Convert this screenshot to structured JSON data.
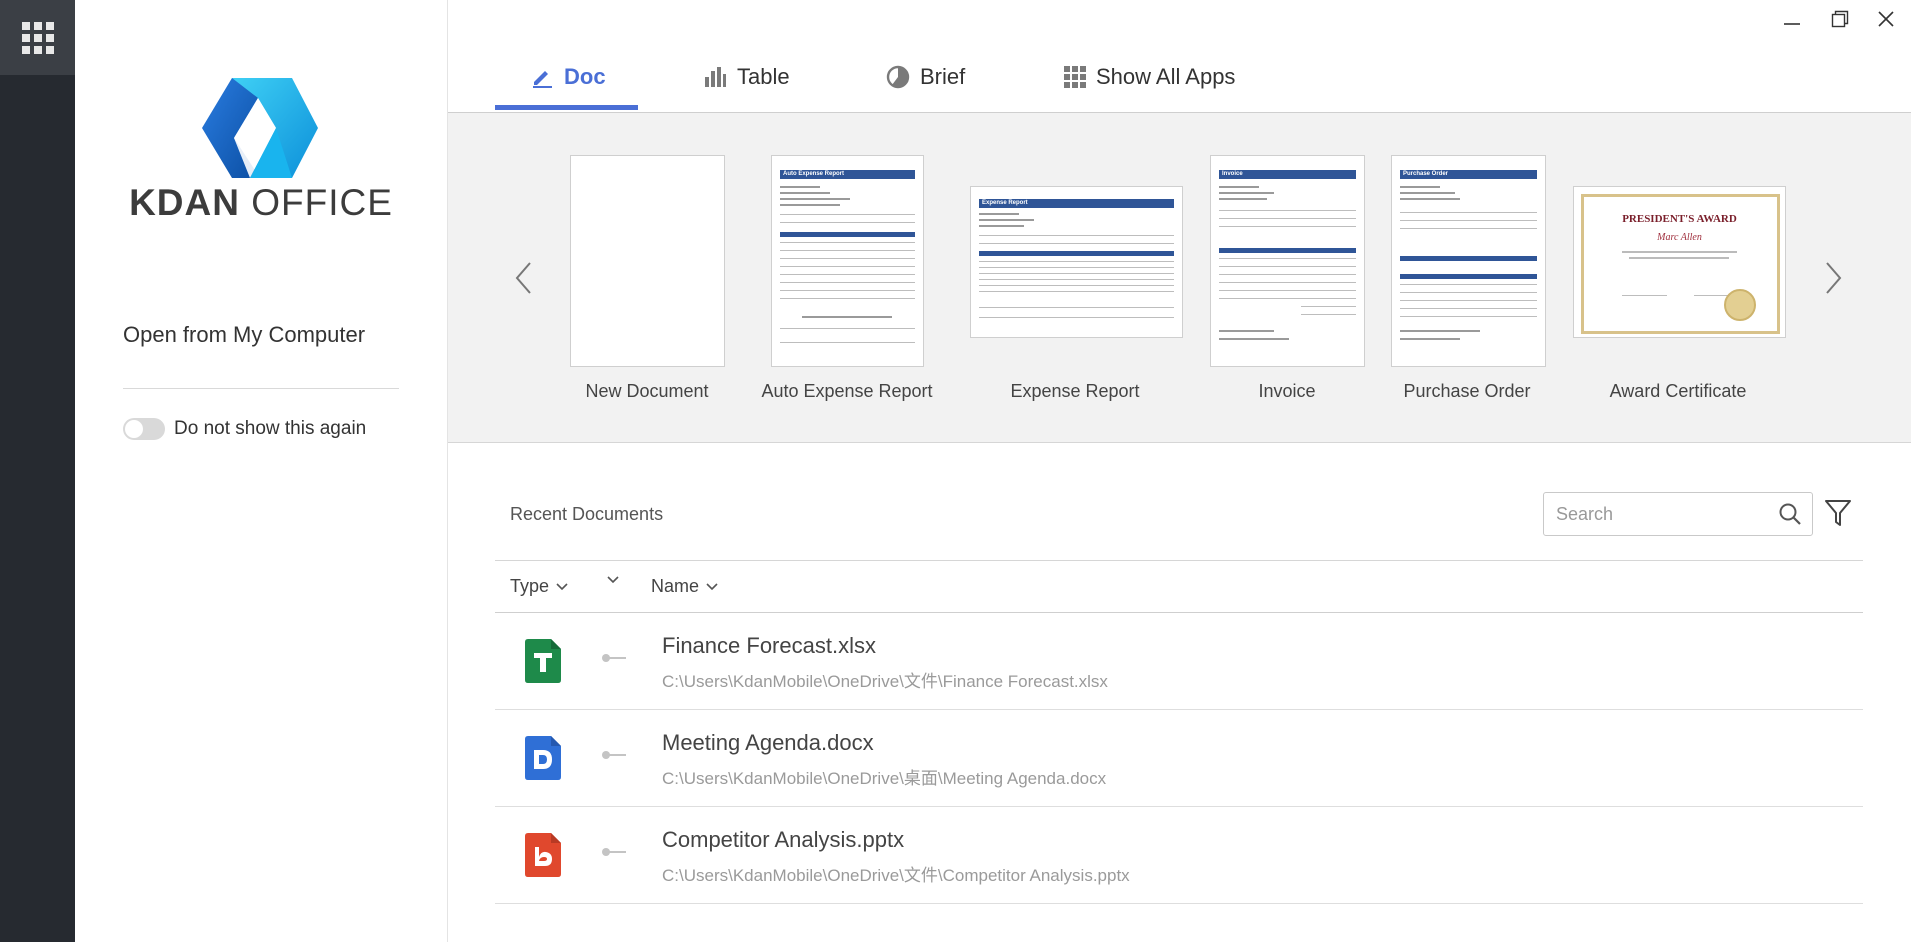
{
  "rail": {
    "apps_icon": "grid-apps-icon"
  },
  "left_panel": {
    "logo_text_bold": "KDAN",
    "logo_text_light": "OFFICE",
    "open_link": "Open from My Computer",
    "toggle_label": "Do not show this again",
    "toggle_on": false
  },
  "window_controls": {
    "minimize": "minimize-icon",
    "restore": "restore-icon",
    "close": "close-icon"
  },
  "tabs": [
    {
      "label": "Doc",
      "icon": "pencil-icon",
      "active": true
    },
    {
      "label": "Table",
      "icon": "bar-chart-icon",
      "active": false
    },
    {
      "label": "Brief",
      "icon": "pie-chart-icon",
      "active": false
    },
    {
      "label": "Show All Apps",
      "icon": "grid-icon",
      "active": false
    }
  ],
  "templates": [
    {
      "label": "New Document"
    },
    {
      "label": "Auto Expense Report",
      "header": "Auto Expense Report"
    },
    {
      "label": "Expense Report",
      "header": "Expense Report"
    },
    {
      "label": "Invoice",
      "header": "Invoice"
    },
    {
      "label": "Purchase Order",
      "header": "Purchase Order"
    },
    {
      "label": "Award Certificate",
      "cert_title": "PRESIDENT'S AWARD",
      "cert_name": "Marc Allen"
    }
  ],
  "recent": {
    "title": "Recent Documents",
    "search_placeholder": "Search",
    "columns": {
      "type": "Type",
      "name": "Name"
    },
    "files": [
      {
        "name": "Finance Forecast.xlsx",
        "path": "C:\\Users\\KdanMobile\\OneDrive\\文件\\Finance Forecast.xlsx",
        "kind": "spreadsheet",
        "color": "#1e8a4a"
      },
      {
        "name": "Meeting Agenda.docx",
        "path": "C:\\Users\\KdanMobile\\OneDrive\\桌面\\Meeting Agenda.docx",
        "kind": "document",
        "color": "#2f6fd6"
      },
      {
        "name": "Competitor Analysis.pptx",
        "path": "C:\\Users\\KdanMobile\\OneDrive\\文件\\Competitor Analysis.pptx",
        "kind": "presentation",
        "color": "#e0482d"
      }
    ]
  },
  "colors": {
    "accent": "#4a6fd6",
    "rail": "#262a30",
    "templates_bg": "#f2f2f2"
  }
}
